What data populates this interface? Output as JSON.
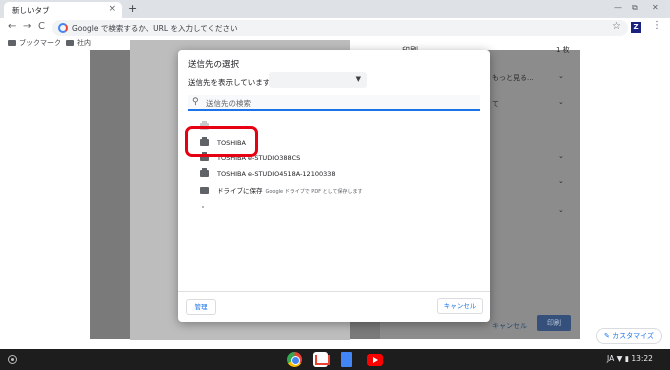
{
  "browser": {
    "tab_title": "新しいタブ",
    "tab_close": "×",
    "new_tab": "+",
    "win_min": "—",
    "win_max": "⧉",
    "win_close": "✕",
    "back": "←",
    "forward": "→",
    "reload": "C",
    "omnibox_placeholder": "Google で検索するか、URL を入力してください",
    "star": "☆",
    "extension": "Z",
    "menu": "⋮",
    "bookmarks": [
      {
        "label": "ブックマーク"
      },
      {
        "label": "社内"
      }
    ]
  },
  "print_panel": {
    "title": "印刷",
    "page_count": "1 枚",
    "row1": "もっと見る...",
    "row2": "て",
    "cancel": "キャンセル",
    "print": "印刷"
  },
  "dialog": {
    "title": "送信先の選択",
    "show_label": "送信先を表示しています:",
    "search_placeholder": "送信先の検索",
    "destinations": [
      {
        "label": "TOSHIBA",
        "icon": "printer-icon"
      },
      {
        "label": "TOSHIBA e-STUDIO388CS",
        "icon": "printer-icon"
      },
      {
        "label": "TOSHIBA e-STUDIO4518A-12100338",
        "icon": "printer-icon"
      },
      {
        "label": "ドライブに保存",
        "sub": "Google ドライブで PDF として保存します",
        "icon": "drive-icon"
      }
    ],
    "manage": "管理",
    "cancel": "キャンセル"
  },
  "customize": "✎ カスタマイズ",
  "shelf": {
    "ime": "JA",
    "time": "13:22"
  },
  "colors": {
    "highlight": "#e60012",
    "accent": "#1a73e8",
    "print_button": "#35507a"
  }
}
